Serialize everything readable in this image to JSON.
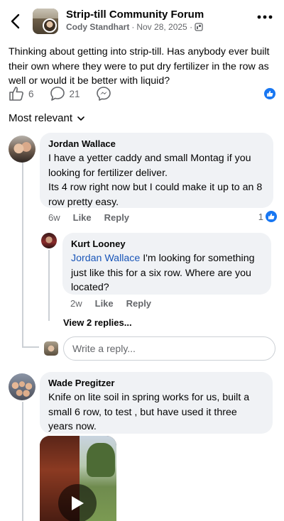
{
  "header": {
    "group_title": "Strip-till Community Forum",
    "author": "Cody Standhart",
    "separator": "·",
    "date": "Nov 28, 2025 ·",
    "icons": [
      "back-arrow-icon",
      "group-icon",
      "more-icon"
    ]
  },
  "post": {
    "text": "Thinking about getting into strip-till. Has anybody ever built their own where they were to put dry fertilizer in the row as well or would it be better with liquid?",
    "like_count": "6",
    "comment_count": "21"
  },
  "sort": {
    "label": "Most relevant"
  },
  "comments": [
    {
      "name": "Jordan Wallace",
      "text_lines": [
        "I have a yetter caddy and small Montag if you looking for fertilizer deliver.",
        "Its 4 row right now but I could make it up to an 8 row pretty easy."
      ],
      "time": "6w",
      "like_label": "Like",
      "reply_label": "Reply",
      "reaction_count": "1"
    },
    {
      "name": "Kurt Looney",
      "mention": "Jordan Wallace",
      "text": " I'm looking for something just like this for a six row. Where are you located?",
      "time": "2w",
      "like_label": "Like",
      "reply_label": "Reply"
    },
    {
      "name": "Wade Pregitzer",
      "text": "Knife on lite soil in spring works for us,   built a small 6 row, to test , but have used it three years now."
    }
  ],
  "view_replies": "View 2 replies...",
  "reply_input": {
    "placeholder": "Write a reply..."
  },
  "colors": {
    "accent": "#1877f2",
    "mention": "#1a56b8",
    "bubble": "#f0f2f5",
    "muted": "#65676b"
  }
}
